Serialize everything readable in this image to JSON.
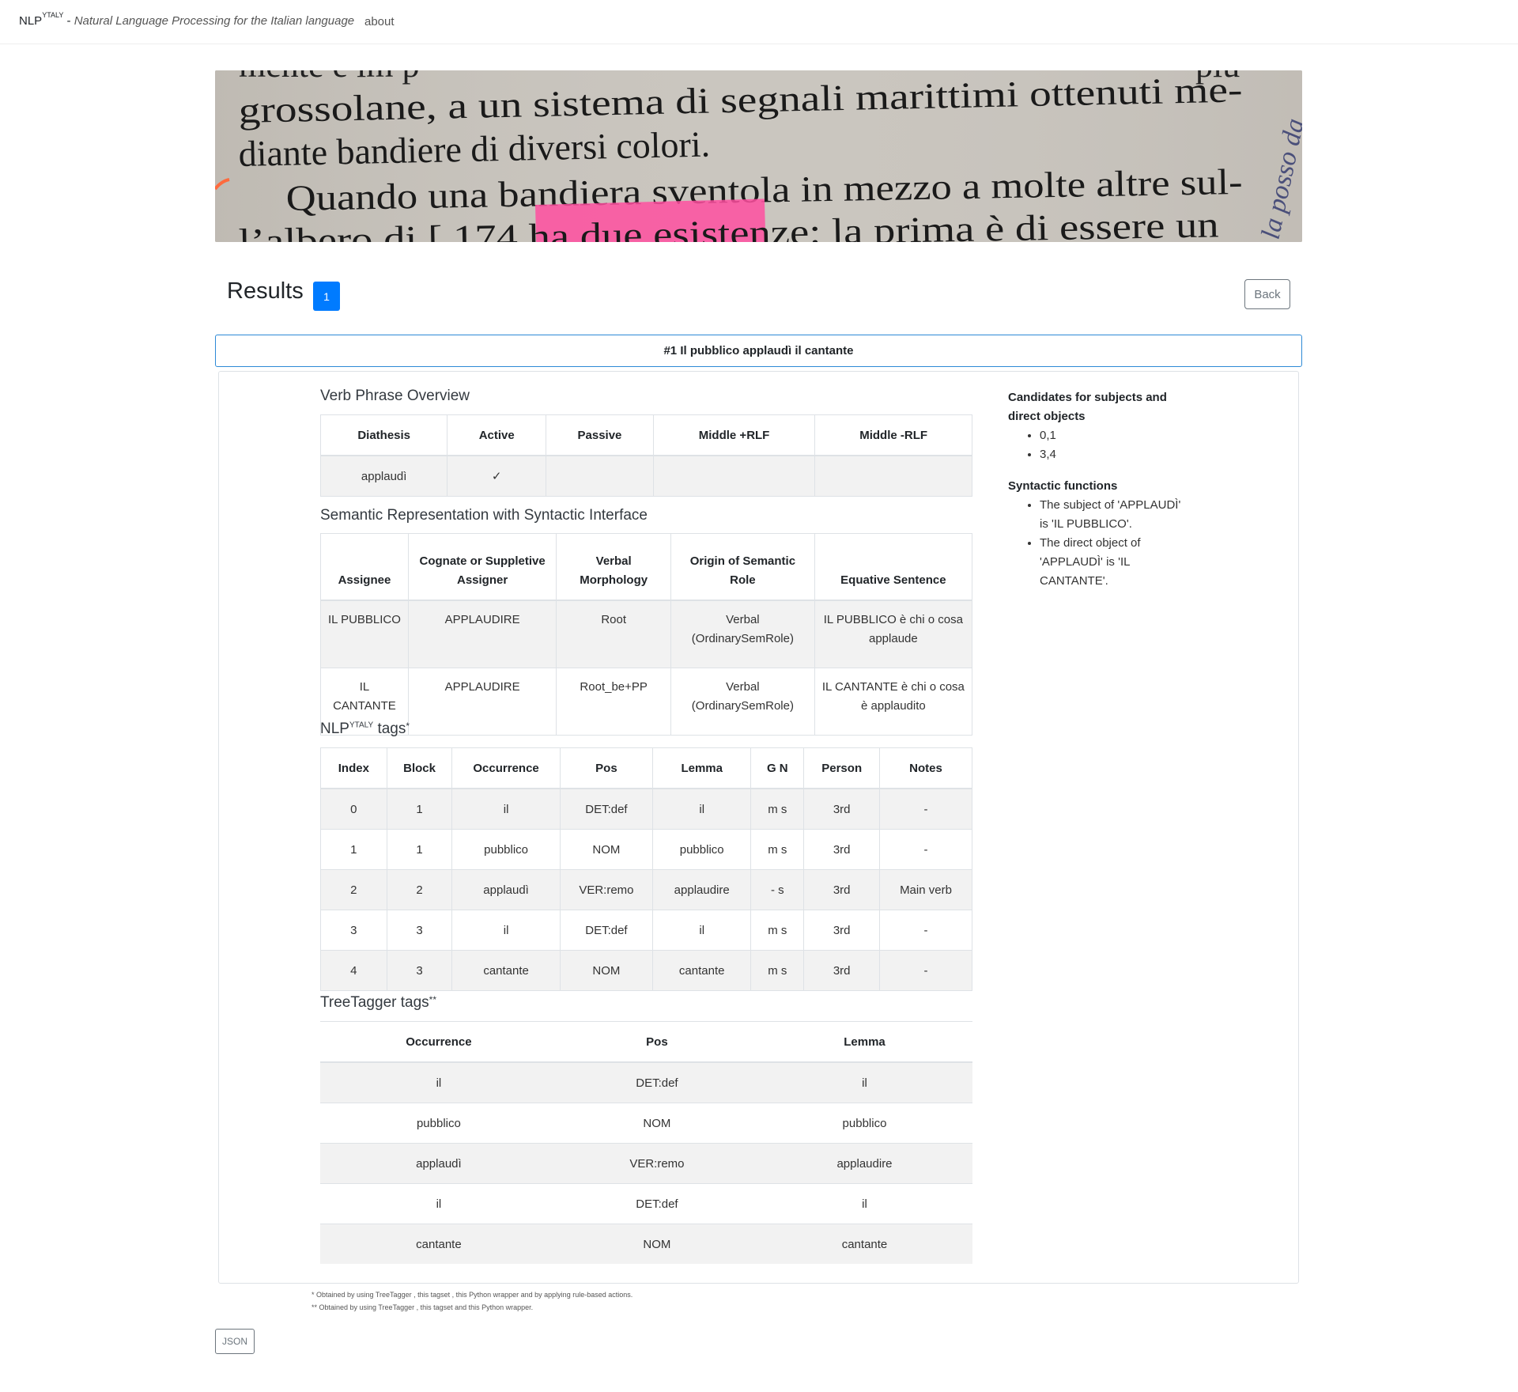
{
  "navbar": {
    "brand": "NLP",
    "brand_sup": "YTALY",
    "separator": " - ",
    "tagline": "Natural Language Processing for the Italian language",
    "about": "about"
  },
  "banner": {
    "lines": [
      "grossolane, a un sistema di segnali marittimi ottenuti me-",
      "diante bandiere di diversi colori.",
      "Quando una bandiera sventola in mezzo a molte altre sul-",
      "l’albero di [ 174 ha due esistenze: la prima è di essere un"
    ],
    "handwriting": "la posso da"
  },
  "results": {
    "title": "Results",
    "count": "1",
    "back": "Back"
  },
  "sentence": {
    "header": "#1 Il pubblico applaudì il cantante"
  },
  "vp": {
    "title": "Verb Phrase Overview",
    "headers": [
      "Diathesis",
      "Active",
      "Passive",
      "Middle +RLF",
      "Middle -RLF"
    ],
    "row": [
      "applaudì",
      "✓",
      "",
      "",
      ""
    ]
  },
  "semantic": {
    "title": "Semantic Representation with Syntactic Interface",
    "headers": [
      "Assignee",
      "Cognate or Suppletive Assigner",
      "Verbal Morphology",
      "Origin of Semantic Role",
      "Equative Sentence"
    ],
    "rows": [
      [
        "IL PUBBLICO",
        "APPLAUDIRE",
        "Root",
        "Verbal (OrdinarySemRole)",
        "IL PUBBLICO è chi o cosa applaude"
      ],
      [
        "IL CANTANTE",
        "APPLAUDIRE",
        "Root_be+PP",
        "Verbal (OrdinarySemRole)",
        "IL CANTANTE è chi o cosa è applaudito"
      ]
    ]
  },
  "nlp_tags": {
    "title_prefix": "NLP",
    "title_sup": "YTALY",
    "title_suffix": " tags",
    "star": "*",
    "headers": [
      "Index",
      "Block",
      "Occurrence",
      "Pos",
      "Lemma",
      "G N",
      "Person",
      "Notes"
    ],
    "rows": [
      [
        "0",
        "1",
        "il",
        "DET:def",
        "il",
        "m s",
        "3rd",
        "-"
      ],
      [
        "1",
        "1",
        "pubblico",
        "NOM",
        "pubblico",
        "m s",
        "3rd",
        "-"
      ],
      [
        "2",
        "2",
        "applaudì",
        "VER:remo",
        "applaudire",
        "- s",
        "3rd",
        "Main verb"
      ],
      [
        "3",
        "3",
        "il",
        "DET:def",
        "il",
        "m s",
        "3rd",
        "-"
      ],
      [
        "4",
        "3",
        "cantante",
        "NOM",
        "cantante",
        "m s",
        "3rd",
        "-"
      ]
    ]
  },
  "treetagger": {
    "title": "TreeTagger tags",
    "star": "**",
    "headers": [
      "Occurrence",
      "Pos",
      "Lemma"
    ],
    "rows": [
      [
        "il",
        "DET:def",
        "il"
      ],
      [
        "pubblico",
        "NOM",
        "pubblico"
      ],
      [
        "applaudì",
        "VER:remo",
        "applaudire"
      ],
      [
        "il",
        "DET:def",
        "il"
      ],
      [
        "cantante",
        "NOM",
        "cantante"
      ]
    ]
  },
  "side": {
    "candidates_title": "Candidates for subjects and direct objects",
    "candidates": [
      "0,1",
      "3,4"
    ],
    "functions_title": "Syntactic functions",
    "functions": [
      "The subject of 'APPLAUDÌ' is 'IL PUBBLICO'.",
      "The direct object of 'APPLAUDÌ' is 'IL CANTANTE'."
    ]
  },
  "footnotes": [
    "* Obtained by using TreeTagger , this tagset , this Python wrapper and by applying rule-based actions.",
    "** Obtained by using TreeTagger , this tagset and this Python wrapper."
  ],
  "json_button": "JSON",
  "colors": {
    "primary": "#007bff",
    "accent_border": "#2d8ad6",
    "stripe": "#f2f2f2",
    "highlight": "#ff4fa0"
  }
}
